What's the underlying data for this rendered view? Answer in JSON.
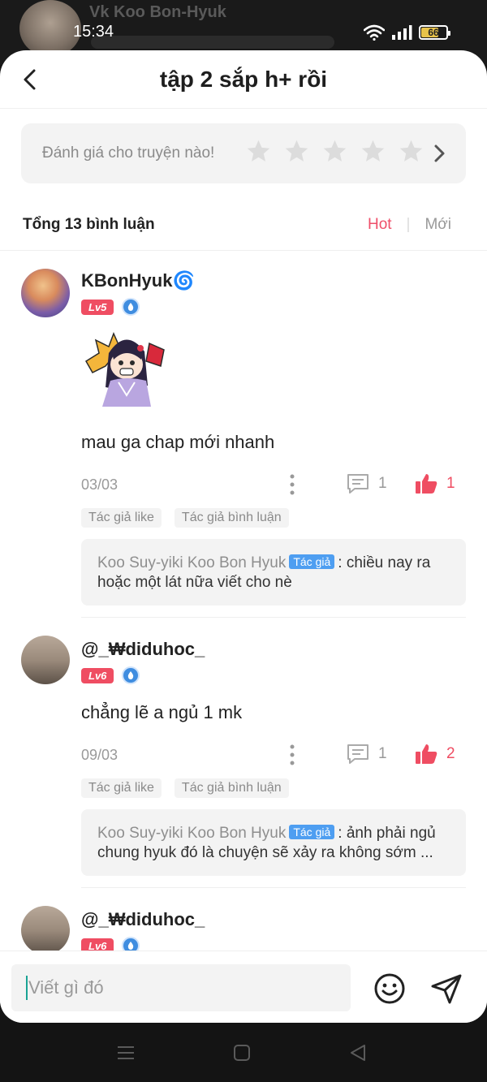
{
  "background": {
    "profile_name": "Vk Koo Bon-Hyuk"
  },
  "status_bar": {
    "time": "15:34",
    "battery": "66"
  },
  "header": {
    "title": "tập 2 sắp h+ rồi"
  },
  "rating": {
    "prompt": "Đánh giá cho truyện nào!",
    "stars": 5
  },
  "summary": {
    "total": "Tổng 13 bình luận",
    "sort_hot": "Hot",
    "sort_separator": "|",
    "sort_new": "Mới"
  },
  "comments": [
    {
      "username": "KBonHyuk🌀",
      "level": "Lv5",
      "text": "mau ga chap mới nhanh",
      "date": "03/03",
      "reply_count": "1",
      "like_count": "1",
      "tags": [
        "Tác giả like",
        "Tác giả bình luận"
      ],
      "reply": {
        "author": "Koo Suy-yiki Koo Bon Hyuk",
        "badge": "Tác giả",
        "text": ": chiều nay ra hoặc một lát nữa viết cho nè"
      }
    },
    {
      "username": "@_₩diduhoc_",
      "level": "Lv6",
      "text": "chẳng lẽ a ngủ 1 mk",
      "date": "09/03",
      "reply_count": "1",
      "like_count": "2",
      "tags": [
        "Tác giả like",
        "Tác giả bình luận"
      ],
      "reply": {
        "author": "Koo Suy-yiki Koo Bon Hyuk",
        "badge": "Tác giả",
        "text": ": ảnh phải ngủ chung hyuk đó là chuyện sẽ xảy ra không sớm ..."
      }
    },
    {
      "username": "@_₩diduhoc_",
      "level": "Lv6"
    }
  ],
  "input": {
    "placeholder": "Viết gì đó"
  },
  "colors": {
    "accent": "#ef4d62",
    "author_badge": "#4e9ef1",
    "caret": "#1aa394"
  }
}
